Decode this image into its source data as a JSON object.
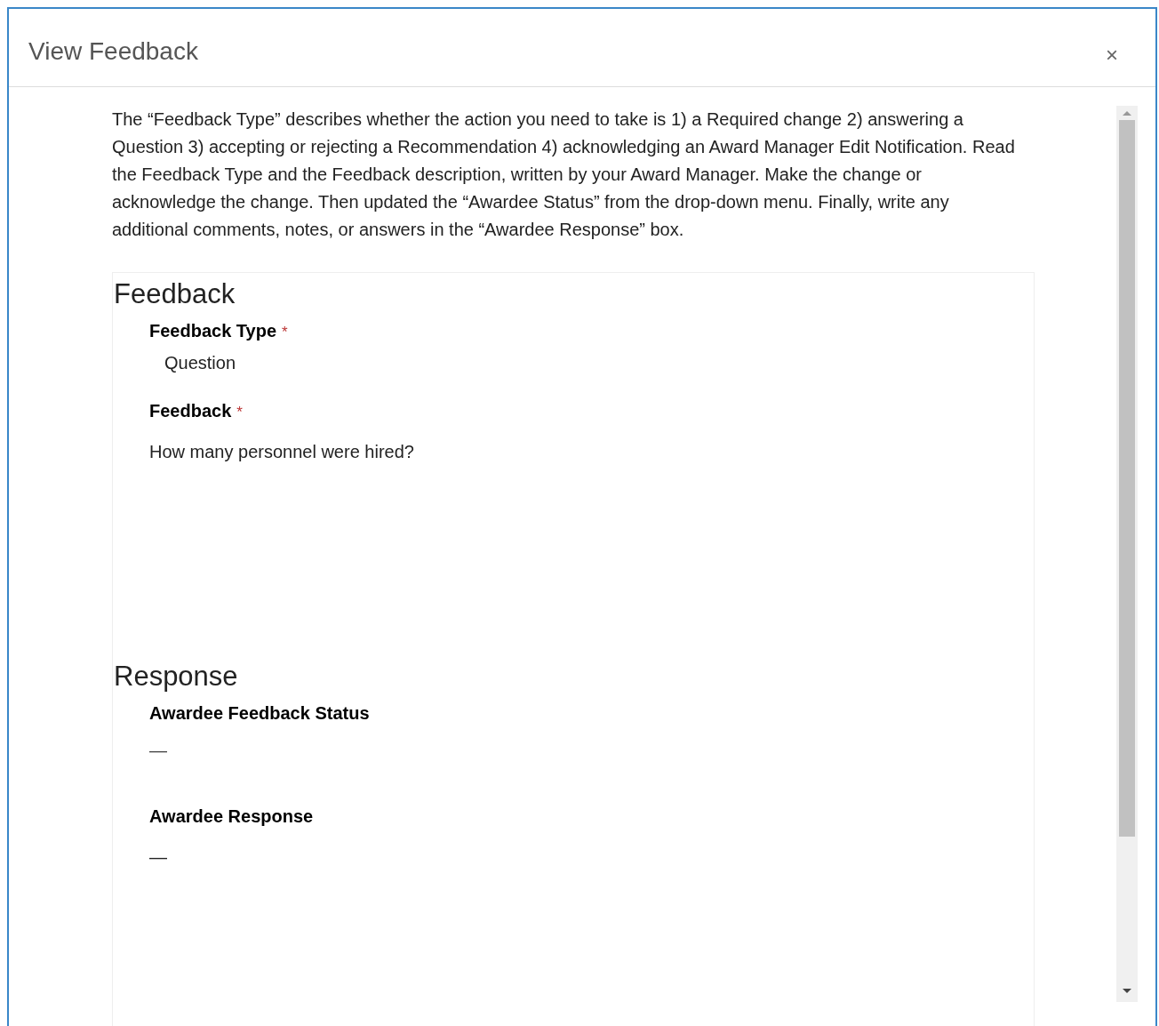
{
  "dialog": {
    "title": "View Feedback",
    "close": "×"
  },
  "instructions": "The “Feedback Type” describes whether the action you need to take is 1) a Required change 2) answering a Question 3) accepting or rejecting a Recommendation 4) acknowledging an Award Manager Edit Notification. Read the Feedback Type and the Feedback description, written by your Award Manager. Make the change or acknowledge the change. Then updated the “Awardee Status” from the drop-down menu. Finally, write any additional comments, notes, or answers in the “Awardee Response” box.",
  "sections": [
    {
      "title": "Feedback",
      "fields": [
        {
          "kind": "option",
          "label": "Feedback Type",
          "required_mark": "*",
          "value": "Question"
        },
        {
          "kind": "multiline",
          "label": "Feedback",
          "required_mark": "*",
          "value": "How many personnel were hired?"
        }
      ]
    },
    {
      "title": "Response",
      "fields": [
        {
          "kind": "text",
          "label": "Awardee Feedback Status",
          "value": "—"
        },
        {
          "kind": "multiline",
          "label": "Awardee Response",
          "value": "—"
        }
      ]
    }
  ]
}
